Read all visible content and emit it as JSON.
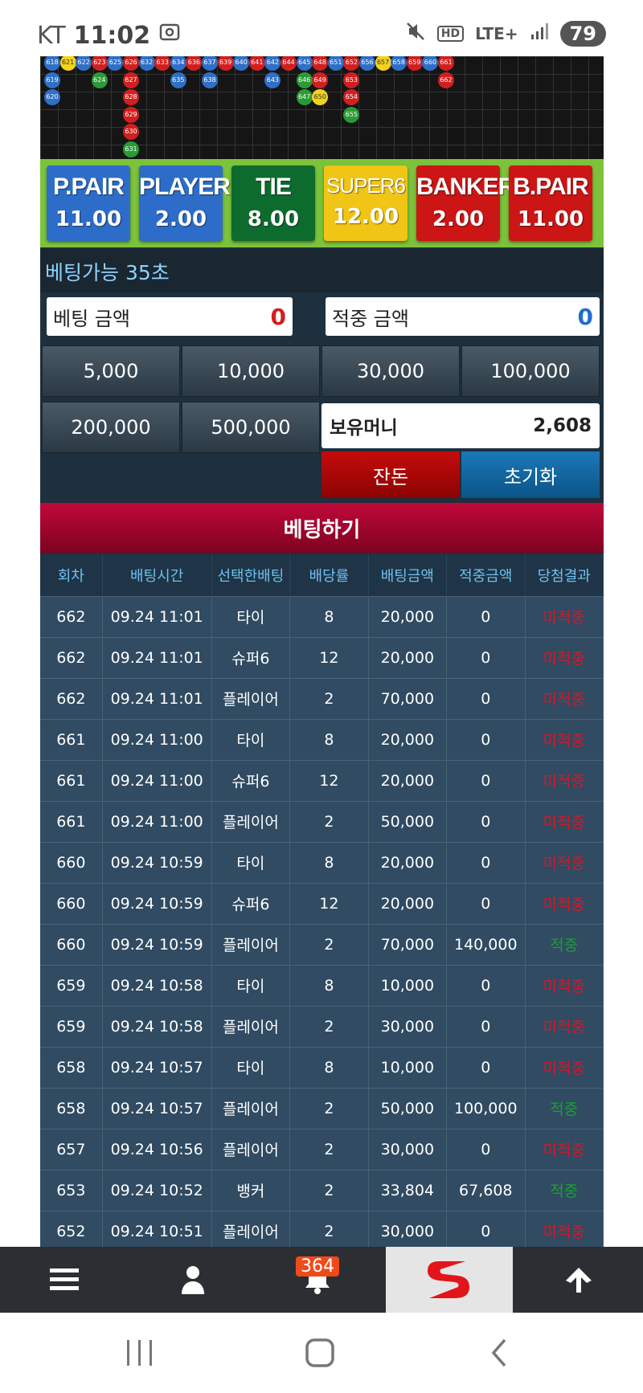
{
  "status_bar": {
    "carrier": "KT",
    "time": "11:02",
    "network": "LTE+",
    "battery": "79"
  },
  "roadmap": {
    "beads": [
      {
        "n": "618",
        "c": "p",
        "col": 0,
        "row": 0
      },
      {
        "n": "621",
        "c": "y",
        "col": 1,
        "row": 0
      },
      {
        "n": "622",
        "c": "p",
        "col": 2,
        "row": 0
      },
      {
        "n": "623",
        "c": "b",
        "col": 3,
        "row": 0
      },
      {
        "n": "625",
        "c": "p",
        "col": 4,
        "row": 0
      },
      {
        "n": "626",
        "c": "b",
        "col": 5,
        "row": 0
      },
      {
        "n": "632",
        "c": "p",
        "col": 6,
        "row": 0
      },
      {
        "n": "633",
        "c": "b",
        "col": 7,
        "row": 0
      },
      {
        "n": "634",
        "c": "p",
        "col": 8,
        "row": 0
      },
      {
        "n": "636",
        "c": "b",
        "col": 9,
        "row": 0
      },
      {
        "n": "637",
        "c": "p",
        "col": 10,
        "row": 0
      },
      {
        "n": "639",
        "c": "b",
        "col": 11,
        "row": 0
      },
      {
        "n": "640",
        "c": "p",
        "col": 12,
        "row": 0
      },
      {
        "n": "641",
        "c": "b",
        "col": 13,
        "row": 0
      },
      {
        "n": "642",
        "c": "p",
        "col": 14,
        "row": 0
      },
      {
        "n": "644",
        "c": "b",
        "col": 15,
        "row": 0
      },
      {
        "n": "645",
        "c": "p",
        "col": 16,
        "row": 0
      },
      {
        "n": "648",
        "c": "b",
        "col": 17,
        "row": 0
      },
      {
        "n": "651",
        "c": "p",
        "col": 18,
        "row": 0
      },
      {
        "n": "652",
        "c": "b",
        "col": 19,
        "row": 0
      },
      {
        "n": "656",
        "c": "p",
        "col": 20,
        "row": 0
      },
      {
        "n": "657",
        "c": "y",
        "col": 21,
        "row": 0
      },
      {
        "n": "658",
        "c": "p",
        "col": 22,
        "row": 0
      },
      {
        "n": "659",
        "c": "b",
        "col": 23,
        "row": 0
      },
      {
        "n": "660",
        "c": "p",
        "col": 24,
        "row": 0
      },
      {
        "n": "661",
        "c": "b",
        "col": 25,
        "row": 0
      },
      {
        "n": "619",
        "c": "p",
        "col": 0,
        "row": 1
      },
      {
        "n": "624",
        "c": "t",
        "col": 3,
        "row": 1
      },
      {
        "n": "627",
        "c": "b",
        "col": 5,
        "row": 1
      },
      {
        "n": "635",
        "c": "p",
        "col": 8,
        "row": 1
      },
      {
        "n": "638",
        "c": "p",
        "col": 10,
        "row": 1
      },
      {
        "n": "643",
        "c": "p",
        "col": 14,
        "row": 1
      },
      {
        "n": "646",
        "c": "t",
        "col": 16,
        "row": 1
      },
      {
        "n": "649",
        "c": "b",
        "col": 17,
        "row": 1
      },
      {
        "n": "653",
        "c": "b",
        "col": 19,
        "row": 1
      },
      {
        "n": "662",
        "c": "b",
        "col": 25,
        "row": 1
      },
      {
        "n": "620",
        "c": "p",
        "col": 0,
        "row": 2
      },
      {
        "n": "628",
        "c": "b",
        "col": 5,
        "row": 2
      },
      {
        "n": "647",
        "c": "t",
        "col": 16,
        "row": 2
      },
      {
        "n": "650",
        "c": "y",
        "col": 17,
        "row": 2
      },
      {
        "n": "654",
        "c": "b",
        "col": 19,
        "row": 2
      },
      {
        "n": "629",
        "c": "b",
        "col": 5,
        "row": 3
      },
      {
        "n": "655",
        "c": "t",
        "col": 19,
        "row": 3
      },
      {
        "n": "630",
        "c": "b",
        "col": 5,
        "row": 4
      },
      {
        "n": "631",
        "c": "t",
        "col": 5,
        "row": 5
      }
    ]
  },
  "bet_options": [
    {
      "name": "P.PAIR",
      "odds": "11.00",
      "color": "#2d6cc9"
    },
    {
      "name": "PLAYER",
      "odds": "2.00",
      "color": "#2d6cc9"
    },
    {
      "name": "TIE",
      "odds": "8.00",
      "color": "#0d6b2e"
    },
    {
      "name": "SUPER6",
      "odds": "12.00",
      "color": "#f1c515"
    },
    {
      "name": "BANKER",
      "odds": "2.00",
      "color": "#cc1515"
    },
    {
      "name": "B.PAIR",
      "odds": "11.00",
      "color": "#cc1515"
    }
  ],
  "countdown": "베팅가능 35초",
  "bet_amount": {
    "label": "베팅 금액",
    "value": "0"
  },
  "win_amount": {
    "label": "적중 금액",
    "value": "0"
  },
  "chips": [
    "5,000",
    "10,000",
    "30,000",
    "100,000",
    "200,000",
    "500,000"
  ],
  "money": {
    "label": "보유머니",
    "value": "2,608"
  },
  "actions": {
    "balance": "잔돈",
    "reset": "초기화"
  },
  "place_bet": "베팅하기",
  "table": {
    "headers": [
      "회차",
      "배팅시간",
      "선택한배팅",
      "배당률",
      "배팅금액",
      "적중금액",
      "당첨결과"
    ],
    "rows": [
      [
        "662",
        "09.24 11:01",
        "타이",
        "8",
        "20,000",
        "0",
        "미적중"
      ],
      [
        "662",
        "09.24 11:01",
        "슈퍼6",
        "12",
        "20,000",
        "0",
        "미적중"
      ],
      [
        "662",
        "09.24 11:01",
        "플레이어",
        "2",
        "70,000",
        "0",
        "미적중"
      ],
      [
        "661",
        "09.24 11:00",
        "타이",
        "8",
        "20,000",
        "0",
        "미적중"
      ],
      [
        "661",
        "09.24 11:00",
        "슈퍼6",
        "12",
        "20,000",
        "0",
        "미적중"
      ],
      [
        "661",
        "09.24 11:00",
        "플레이어",
        "2",
        "50,000",
        "0",
        "미적중"
      ],
      [
        "660",
        "09.24 10:59",
        "타이",
        "8",
        "20,000",
        "0",
        "미적중"
      ],
      [
        "660",
        "09.24 10:59",
        "슈퍼6",
        "12",
        "20,000",
        "0",
        "미적중"
      ],
      [
        "660",
        "09.24 10:59",
        "플레이어",
        "2",
        "70,000",
        "140,000",
        "적중"
      ],
      [
        "659",
        "09.24 10:58",
        "타이",
        "8",
        "10,000",
        "0",
        "미적중"
      ],
      [
        "659",
        "09.24 10:58",
        "플레이어",
        "2",
        "30,000",
        "0",
        "미적중"
      ],
      [
        "658",
        "09.24 10:57",
        "타이",
        "8",
        "10,000",
        "0",
        "미적중"
      ],
      [
        "658",
        "09.24 10:57",
        "플레이어",
        "2",
        "50,000",
        "100,000",
        "적중"
      ],
      [
        "657",
        "09.24 10:56",
        "플레이어",
        "2",
        "30,000",
        "0",
        "미적중"
      ],
      [
        "653",
        "09.24 10:52",
        "뱅커",
        "2",
        "33,804",
        "67,608",
        "적중"
      ],
      [
        "652",
        "09.24 10:51",
        "플레이어",
        "2",
        "30,000",
        "0",
        "미적중"
      ]
    ]
  },
  "bottom_nav": {
    "notification_count": "364"
  },
  "colors": {
    "miss": "#d0192a",
    "hit": "#1aa032",
    "header_text": "#6fc0f0"
  }
}
